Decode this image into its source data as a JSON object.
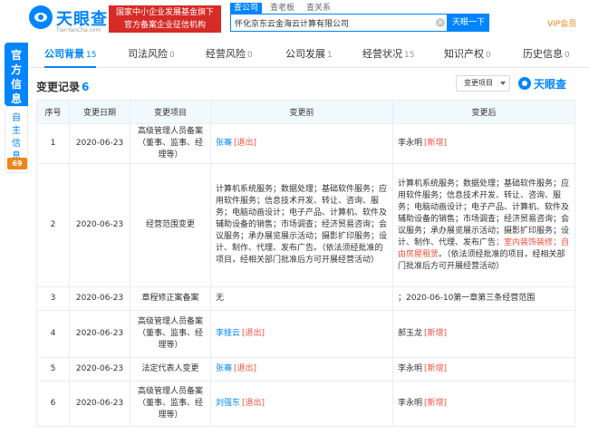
{
  "header": {
    "logo_text": "天眼查",
    "logo_sub": "TianYanCha.com",
    "gov_badge_line1": "国家中小企业发展基金旗下",
    "gov_badge_line2": "官方备案企业征信机构",
    "search_tabs": [
      "查公司",
      "查老板",
      "查关系"
    ],
    "search_value": "怀化京东云金海云计算有限公司",
    "search_button": "天眼一下",
    "vip_label": "VIP会员"
  },
  "side": {
    "official": "官方信息",
    "self_line1": "自主",
    "self_line2": "信息",
    "self_count": "69"
  },
  "tabs": [
    {
      "label": "公司背景",
      "count": "15"
    },
    {
      "label": "司法风险",
      "count": "0"
    },
    {
      "label": "经营风险",
      "count": "0"
    },
    {
      "label": "公司发展",
      "count": "1"
    },
    {
      "label": "经营状况",
      "count": "15"
    },
    {
      "label": "知识产权",
      "count": "0"
    },
    {
      "label": "历史信息",
      "count": "0"
    }
  ],
  "section": {
    "title": "变更记录",
    "count": "6",
    "filter_label": "变更项目",
    "watermark": "天眼查"
  },
  "table": {
    "headers": [
      "序号",
      "变更日期",
      "变更项目",
      "变更前",
      "变更后"
    ],
    "rows": [
      {
        "seq": "1",
        "date": "2020-06-23",
        "item": "高级管理人员备案（董事、监事、经理等）",
        "before_name": "张骞",
        "before_tag": "[退出]",
        "after_name": "李永明",
        "after_tag": "[新增]"
      },
      {
        "seq": "2",
        "date": "2020-06-23",
        "item": "经营范围变更",
        "before_text": "计算机系统服务；数据处理；基础软件服务；应用软件服务；信息技术开发、转让、咨询、服务；电脑动画设计；电子产品、计算机、软件及辅助设备的销售；市场调查；经济贸易咨询；会议服务；承办展览展示活动；摄影扩印服务；设计、制作、代理、发布广告。（依法须经批准的项目，经相关部门批准后方可开展经营活动）",
        "after_text_1": "计算机系统服务；数据处理；基础软件服务；应用软件服务；信息技术开发、转让、咨询、服务；电脑动画设计；电子产品、计算机、软件及辅助设备的销售；市场调查；经济贸易咨询；会议服务；承办展览展示活动；摄影扩印服务；设计、制作、代理、发布广告",
        "after_text_red": "；室内装饰装修；自由房屋租赁",
        "after_text_2": "。（依法须经批准的项目，经相关部门批准后方可开展经营活动）"
      },
      {
        "seq": "3",
        "date": "2020-06-23",
        "item": "章程修正案备案",
        "before_text": "无",
        "after_text": "；2020-06-10第一章第三条经营范围"
      },
      {
        "seq": "4",
        "date": "2020-06-23",
        "item": "高级管理人员备案（董事、监事、经理等）",
        "before_name": "李娅云",
        "before_tag": "[退出]",
        "after_name": "郝玉龙",
        "after_tag": "[新增]"
      },
      {
        "seq": "5",
        "date": "2020-06-23",
        "item": "法定代表人变更",
        "before_name": "张骞",
        "before_tag": "[退出]",
        "after_name": "李永明",
        "after_tag": "[新增]"
      },
      {
        "seq": "6",
        "date": "2020-06-23",
        "item": "高级管理人员备案（董事、监事、经理等）",
        "before_name": "刘强东",
        "before_tag": "[退出]",
        "after_name": "李永明",
        "after_tag": "[新增]"
      }
    ]
  }
}
